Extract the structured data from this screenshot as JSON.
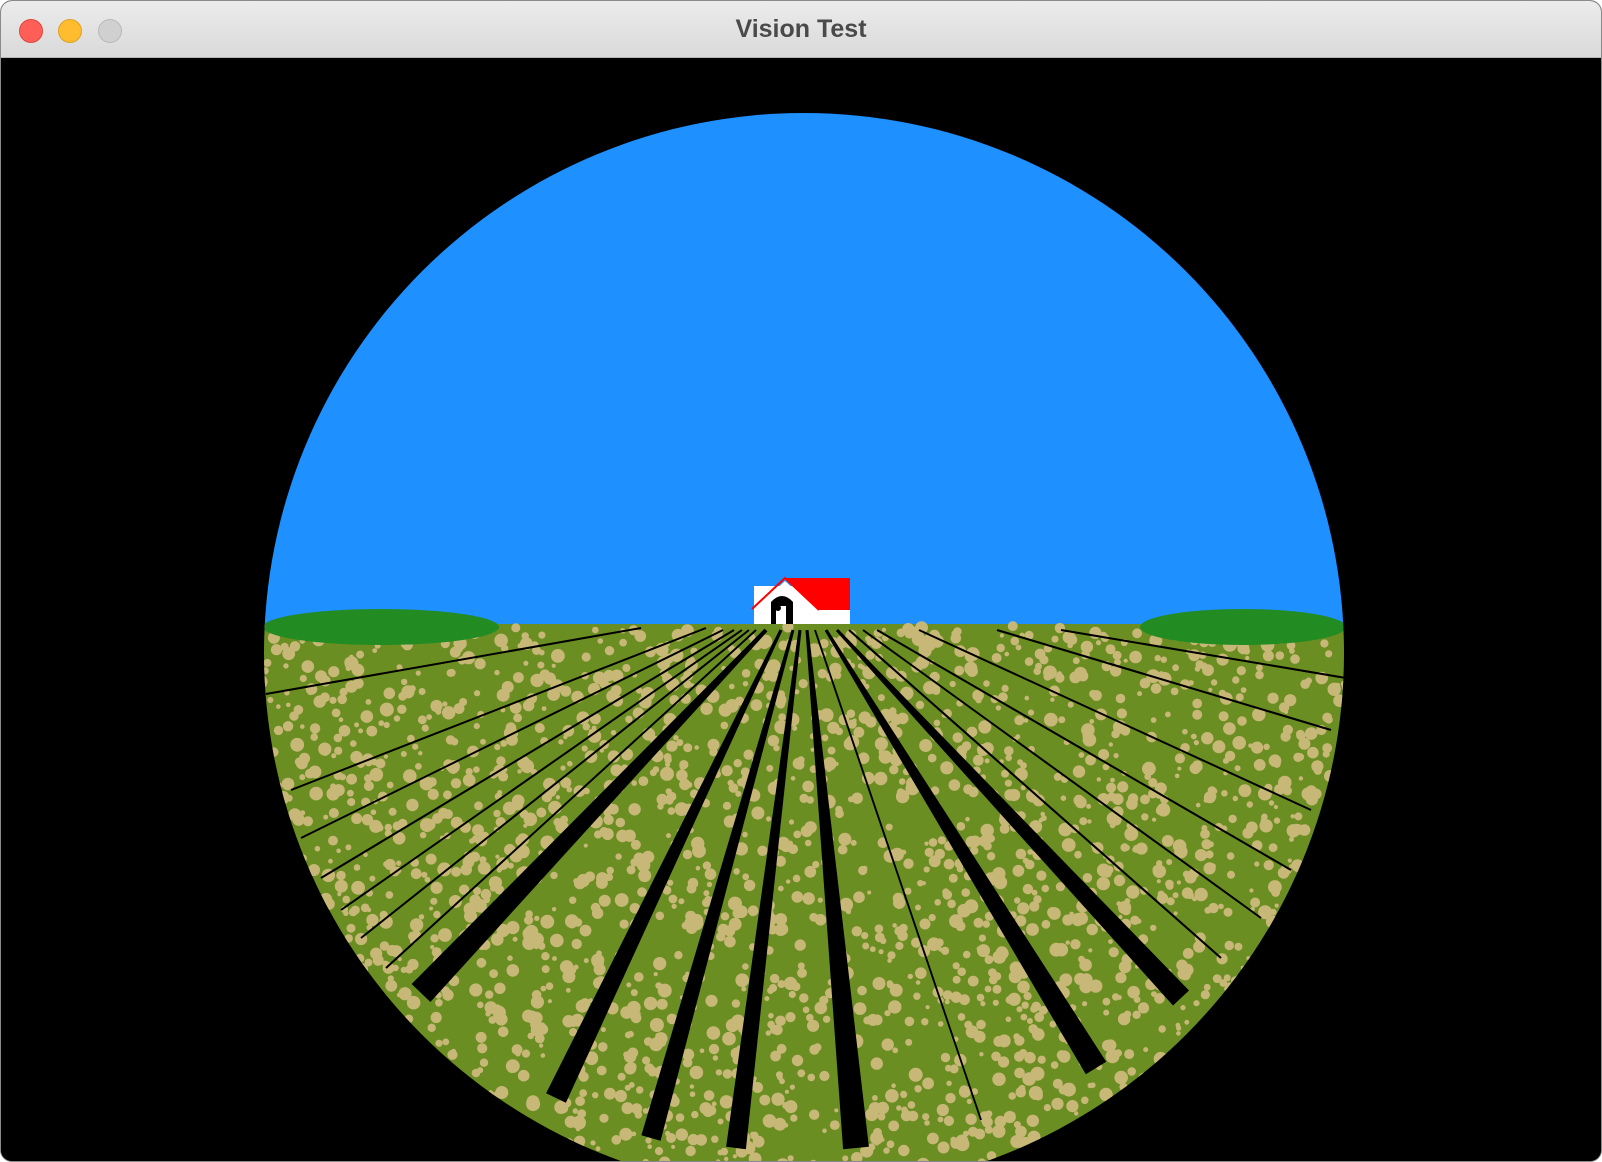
{
  "window": {
    "title": "Vision Test",
    "controls": {
      "close": "close-button",
      "minimize": "minimize-button",
      "zoom": "zoom-button"
    }
  },
  "scene": {
    "colors": {
      "background": "#000000",
      "sky": "#1e90ff",
      "field": "#6b8e23",
      "speckle": "#c8b878",
      "hills": "#228b22",
      "barn_wall": "#ffffff",
      "barn_roof": "#ff0000",
      "barn_door": "#000000",
      "furrow": "#000000"
    },
    "objects": [
      "sky",
      "field",
      "left-hill",
      "right-hill",
      "barn",
      "furrows"
    ]
  }
}
